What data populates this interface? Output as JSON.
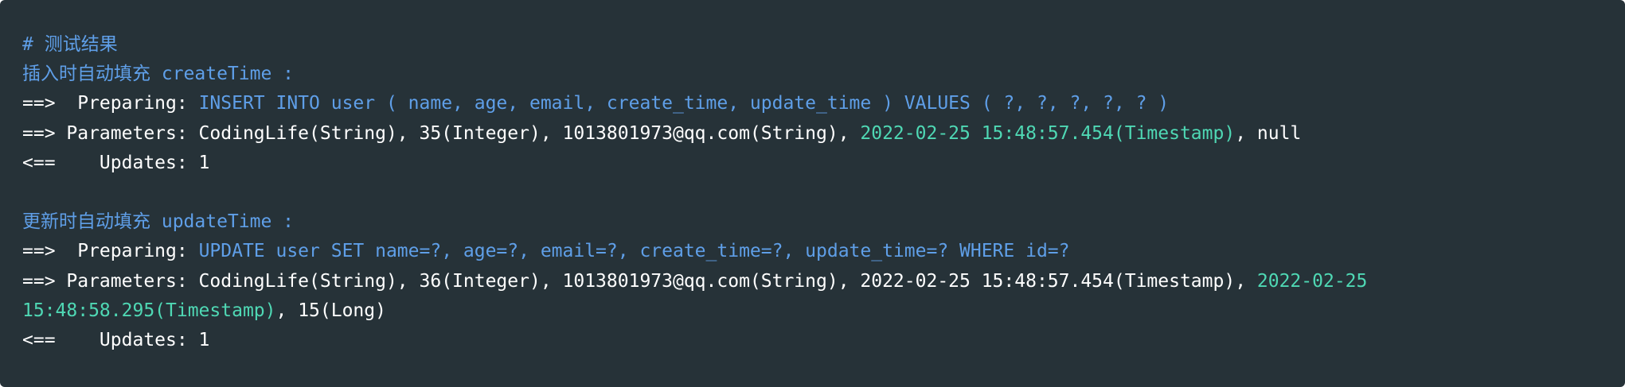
{
  "code": {
    "comment": "# 测试结果",
    "insert_heading": "插入时自动填充 createTime :",
    "insert_preparing_prefix": "==>  Preparing: ",
    "insert_sql": "INSERT INTO user ( name, age, email, create_time, update_time ) VALUES ( ?, ?, ?, ?, ? )",
    "insert_params_prefix": "==> Parameters: CodingLife(String), 35(Integer), 1013801973@qq.com(String), ",
    "insert_params_timestamp": "2022-02-25 15:48:57.454(Timestamp)",
    "insert_params_suffix": ", null",
    "insert_updates": "<==    Updates: 1",
    "update_heading": "更新时自动填充 updateTime :",
    "update_preparing_prefix": "==>  Preparing: ",
    "update_sql": "UPDATE user SET name=?, age=?, email=?, create_time=?, update_time=? WHERE id=?",
    "update_params_prefix": "==> Parameters: CodingLife(String), 36(Integer), 1013801973@qq.com(String), 2022-02-25 15:48:57.454(Timestamp), ",
    "update_params_timestamp_part1": "2022-02-25",
    "update_params_timestamp_part2": "15:48:58.295(Timestamp)",
    "update_params_suffix": ", 15(Long)",
    "update_updates": "<==    Updates: 1"
  },
  "colors": {
    "background": "#263238",
    "keyword_blue": "#5f9fe8",
    "timestamp_teal": "#4fd8b4",
    "text": "#ffffff"
  }
}
